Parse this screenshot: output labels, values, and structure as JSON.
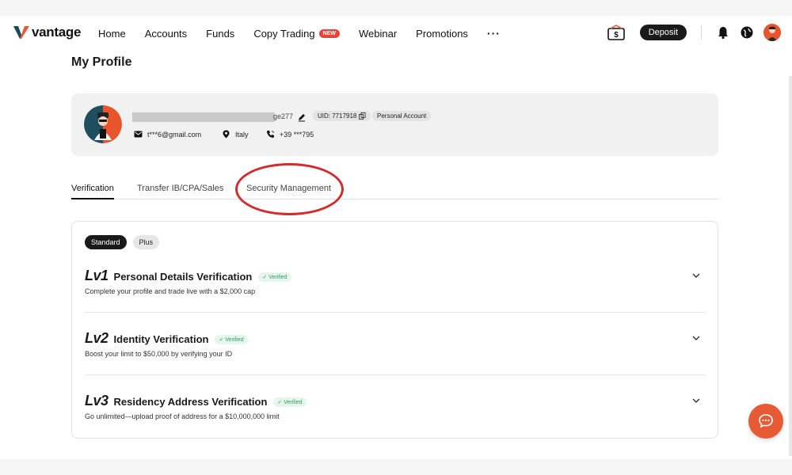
{
  "brand": {
    "name": "vantage",
    "accent": "#e65a36",
    "logo_color": "#1a4a5a"
  },
  "nav": {
    "items": [
      {
        "label": "Home"
      },
      {
        "label": "Accounts"
      },
      {
        "label": "Funds"
      },
      {
        "label": "Copy Trading",
        "badge": "NEW"
      },
      {
        "label": "Webinar"
      },
      {
        "label": "Promotions"
      }
    ],
    "more": "···",
    "deposit_label": "Deposit"
  },
  "page": {
    "title": "My Profile"
  },
  "profile": {
    "name_suffix": "ge277",
    "uid": "UID: 7717918",
    "account_type": "Personal Account",
    "email": "t***6@gmail.com",
    "country": "Italy",
    "phone": "+39 ***795"
  },
  "tabs": [
    {
      "label": "Verification",
      "active": true
    },
    {
      "label": "Transfer IB/CPA/Sales",
      "active": false
    },
    {
      "label": "Security Management",
      "active": false
    }
  ],
  "verification": {
    "plans": [
      {
        "label": "Standard",
        "selected": true
      },
      {
        "label": "Plus",
        "selected": false
      }
    ],
    "levels": [
      {
        "lv": "Lv1",
        "title": "Personal Details Verification",
        "status": "✓ Verified",
        "desc": "Complete your profile and trade live with a $2,000 cap"
      },
      {
        "lv": "Lv2",
        "title": "Identity Verification",
        "status": "✓ Verified",
        "desc": "Boost your limit to $50,000 by verifying your ID"
      },
      {
        "lv": "Lv3",
        "title": "Residency Address Verification",
        "status": "✓ Verified",
        "desc": "Go unlimited—upload proof of address for a $10,000,000 limit"
      }
    ]
  }
}
